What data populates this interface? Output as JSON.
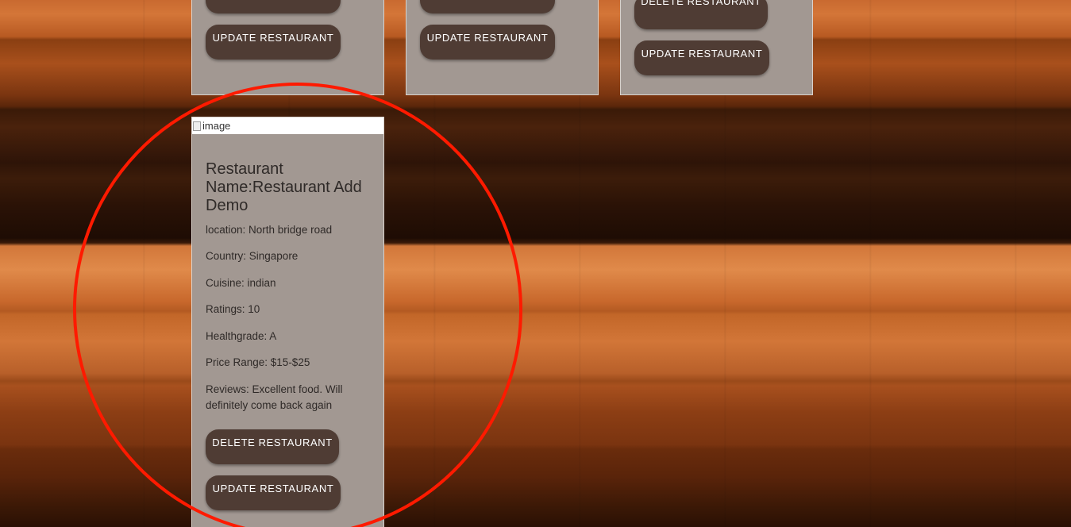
{
  "top_cards": [
    {
      "update_label": "UPDATE RESTAURANT"
    },
    {
      "update_label": "UPDATE RESTAURANT"
    },
    {
      "delete_label": "DELETE RESTAURANT",
      "update_label": "UPDATE RESTAURANT"
    }
  ],
  "featured_card": {
    "image_alt": "image",
    "name": "Restaurant Name:Restaurant Add Demo",
    "location": "location: North bridge road",
    "country": "Country: Singapore",
    "cuisine": "Cuisine: indian",
    "ratings": "Ratings: 10",
    "healthgrade": "Healthgrade: A",
    "price_range": "Price Range: $15-$25",
    "reviews": "Reviews: Excellent food. Will definitely come back again",
    "delete_label": "DELETE RESTAURANT",
    "update_label": "UPDATE RESTAURANT"
  },
  "colors": {
    "card_background": "#a29892",
    "button_background": "#4f3c34",
    "annotation_circle": "#ff1a00"
  },
  "icons": {
    "broken_image": "broken-image-icon"
  }
}
